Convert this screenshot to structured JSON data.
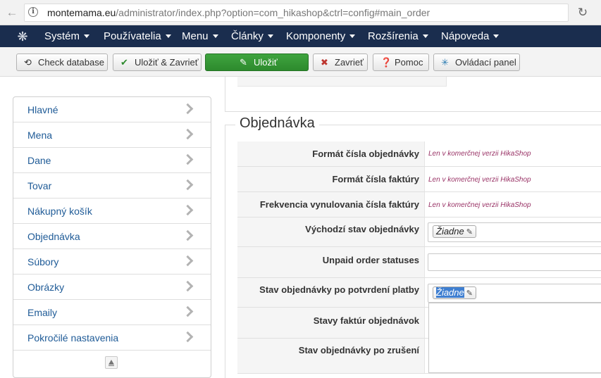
{
  "browser": {
    "url_host": "montemama.eu",
    "url_path": "/administrator/index.php?option=com_hikashop&ctrl=config#main_order"
  },
  "menubar": {
    "items": [
      "Systém",
      "Používatelia",
      "Menu",
      "Články",
      "Komponenty",
      "Rozšírenia",
      "Nápoveda"
    ]
  },
  "toolbar": {
    "check_database": "Check database",
    "save_close": "Uložiť & Zavrieť",
    "save": "Uložiť",
    "close": "Zavrieť",
    "help": "Pomoc",
    "control_panel": "Ovládací panel"
  },
  "sidebar": {
    "items": [
      "Hlavné",
      "Mena",
      "Dane",
      "Tovar",
      "Nákupný košík",
      "Objednávka",
      "Súbory",
      "Obrázky",
      "Emaily",
      "Pokročilé nastavenia"
    ]
  },
  "section": {
    "legend": "Objednávka",
    "rows": [
      {
        "label": "Formát čísla objednávky",
        "note": "Len v komerčnej verzii HikaShop"
      },
      {
        "label": "Formát čísla faktúry",
        "note": "Len v komerčnej verzii HikaShop"
      },
      {
        "label": "Frekvencia vynulovania čísla faktúry",
        "note": "Len v komerčnej verzii HikaShop"
      },
      {
        "label": "Východzí stav objednávky",
        "chip": "Žiadne"
      },
      {
        "label": "Unpaid order statuses"
      },
      {
        "label": "Stav objednávky po potvrdení platby",
        "chip": "Žiadne"
      },
      {
        "label": "Stavy faktúr objednávok"
      },
      {
        "label": "Stav objednávky po zrušení"
      }
    ]
  },
  "colors": {
    "menubar": "#1a2d4e",
    "link": "#1f5b97",
    "note": "#993366",
    "save_button": "#2d8a2d",
    "selection": "#3f7fd1"
  }
}
